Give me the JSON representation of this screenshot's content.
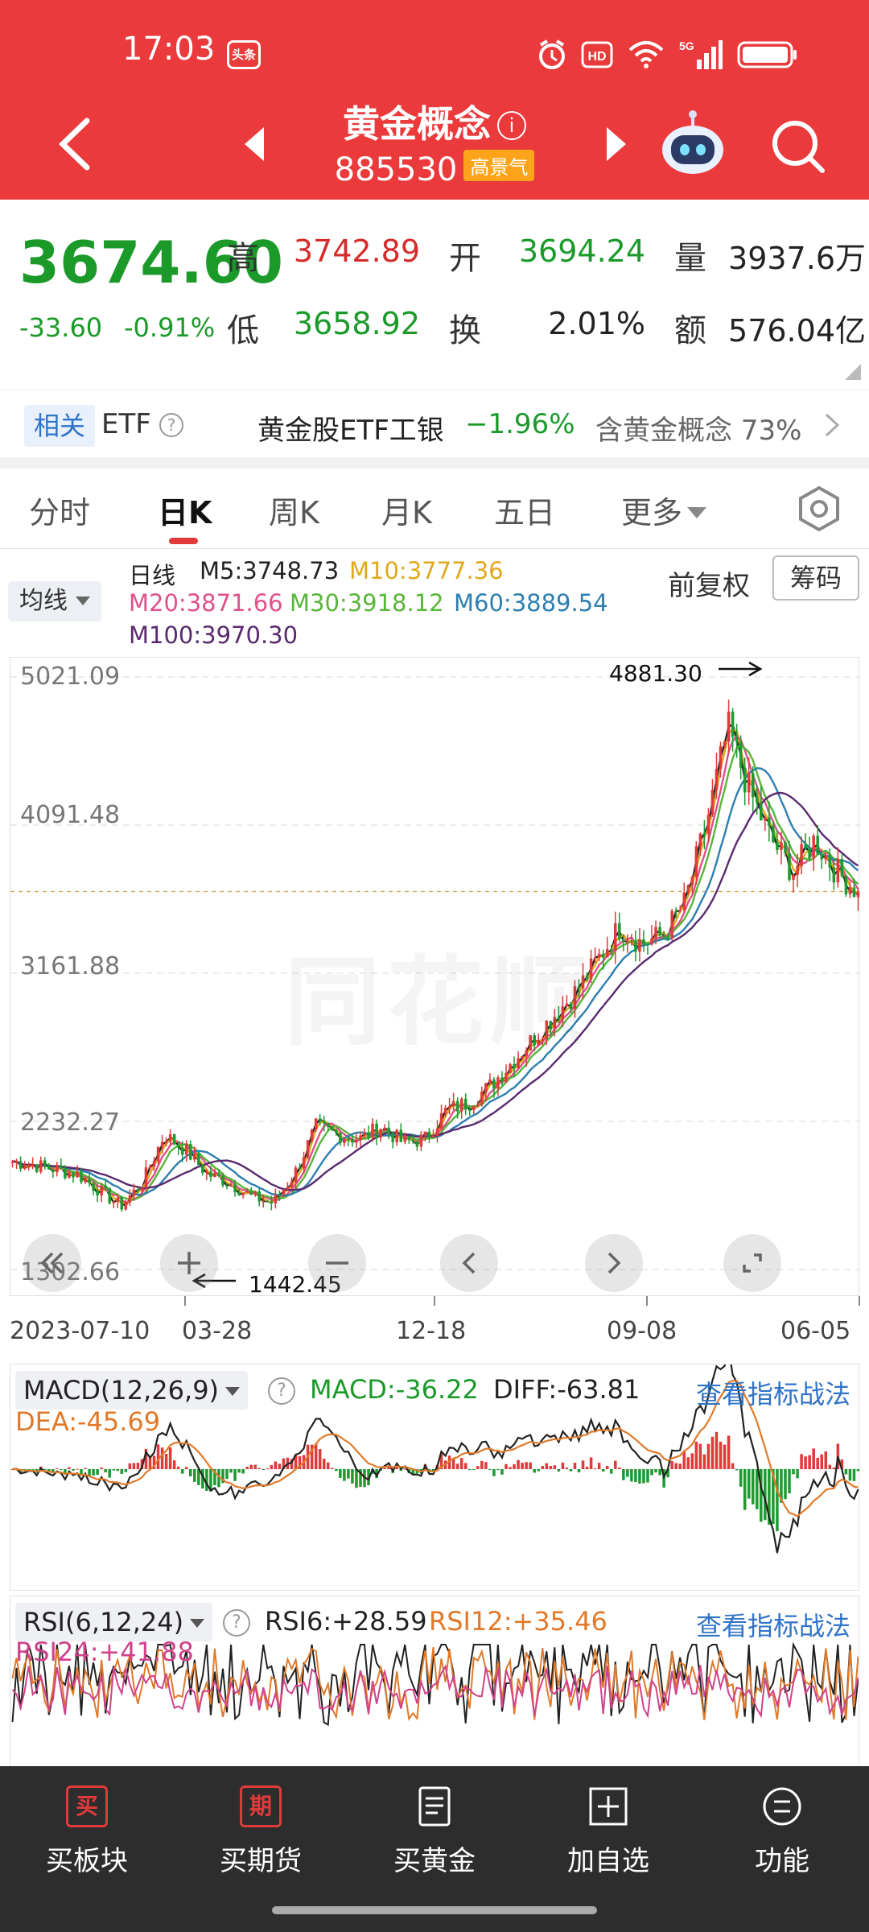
{
  "status_bar": {
    "time": "17:03",
    "news_badge": "头条",
    "network": "5G"
  },
  "header": {
    "title": "黄金概念",
    "code": "885530",
    "badge": "高景气",
    "info_icon": "info-icon"
  },
  "quote": {
    "price": "3674.60",
    "change": "-33.60",
    "change_pct": "-0.91%",
    "high_label": "高",
    "high": "3742.89",
    "open_label": "开",
    "open": "3694.24",
    "volume_label": "量",
    "volume": "3937.6万",
    "low_label": "低",
    "low": "3658.92",
    "turnover_label": "换",
    "turnover": "2.01%",
    "amount_label": "额",
    "amount": "576.04亿"
  },
  "etf": {
    "tag": "相关",
    "label": "ETF",
    "name": "黄金股ETF工银",
    "change": "−1.96%",
    "concentration": "含黄金概念 73%"
  },
  "tabs": [
    {
      "label": "分时"
    },
    {
      "label": "日K"
    },
    {
      "label": "周K"
    },
    {
      "label": "月K"
    },
    {
      "label": "五日"
    },
    {
      "label": "更多"
    }
  ],
  "ma_legend": {
    "selector": "均线",
    "period": "日线",
    "m5": "M5:3748.73",
    "m10": "M10:3777.36",
    "m20": "M20:3871.66",
    "m30": "M30:3918.12",
    "m60": "M60:3889.54",
    "m100": "M100:3970.30",
    "adjust": "前复权",
    "chip_button": "筹码",
    "colors": {
      "m5": "#222222",
      "m10": "#e0a91c",
      "m20": "#e0508a",
      "m30": "#58b63a",
      "m60": "#2c7fb0",
      "m100": "#5a2a6e"
    }
  },
  "chart_data": {
    "type": "candlestick",
    "y_ticks": [
      "5021.09",
      "4091.48",
      "3161.88",
      "2232.27",
      "1302.66"
    ],
    "x_ticks": [
      "2023-07-10",
      "03-28",
      "12-18",
      "09-08",
      "06-05"
    ],
    "high_annotation": "4881.30",
    "low_annotation": "1442.45",
    "current_price_line": 3674.6,
    "ylim": [
      1302.66,
      5021.09
    ],
    "watermark": "同花顺",
    "series_close_approx": [
      1980,
      1960,
      1930,
      1900,
      1800,
      1700,
      1850,
      2150,
      2050,
      1900,
      1850,
      1760,
      1720,
      1900,
      2200,
      2150,
      2120,
      2200,
      2100,
      2120,
      2300,
      2350,
      2450,
      2600,
      2750,
      2900,
      3050,
      3250,
      3450,
      3350,
      3400,
      3600,
      4100,
      4700,
      4300,
      4000,
      3800,
      4000,
      3800,
      3674.6
    ]
  },
  "macd": {
    "selector": "MACD(12,26,9)",
    "macd": "MACD:-36.22",
    "diff": "DIFF:-63.81",
    "dea": "DEA:-45.69",
    "link": "查看指标战法"
  },
  "rsi": {
    "selector": "RSI(6,12,24)",
    "rsi6": "RSI6:+28.59",
    "rsi12": "RSI12:+35.46",
    "rsi24": "RSI24:+41.88",
    "link": "查看指标战法"
  },
  "bottom_nav": [
    {
      "label": "买板块",
      "icon_text": "买"
    },
    {
      "label": "买期货",
      "icon_text": "期"
    },
    {
      "label": "买黄金"
    },
    {
      "label": "加自选"
    },
    {
      "label": "功能"
    }
  ]
}
